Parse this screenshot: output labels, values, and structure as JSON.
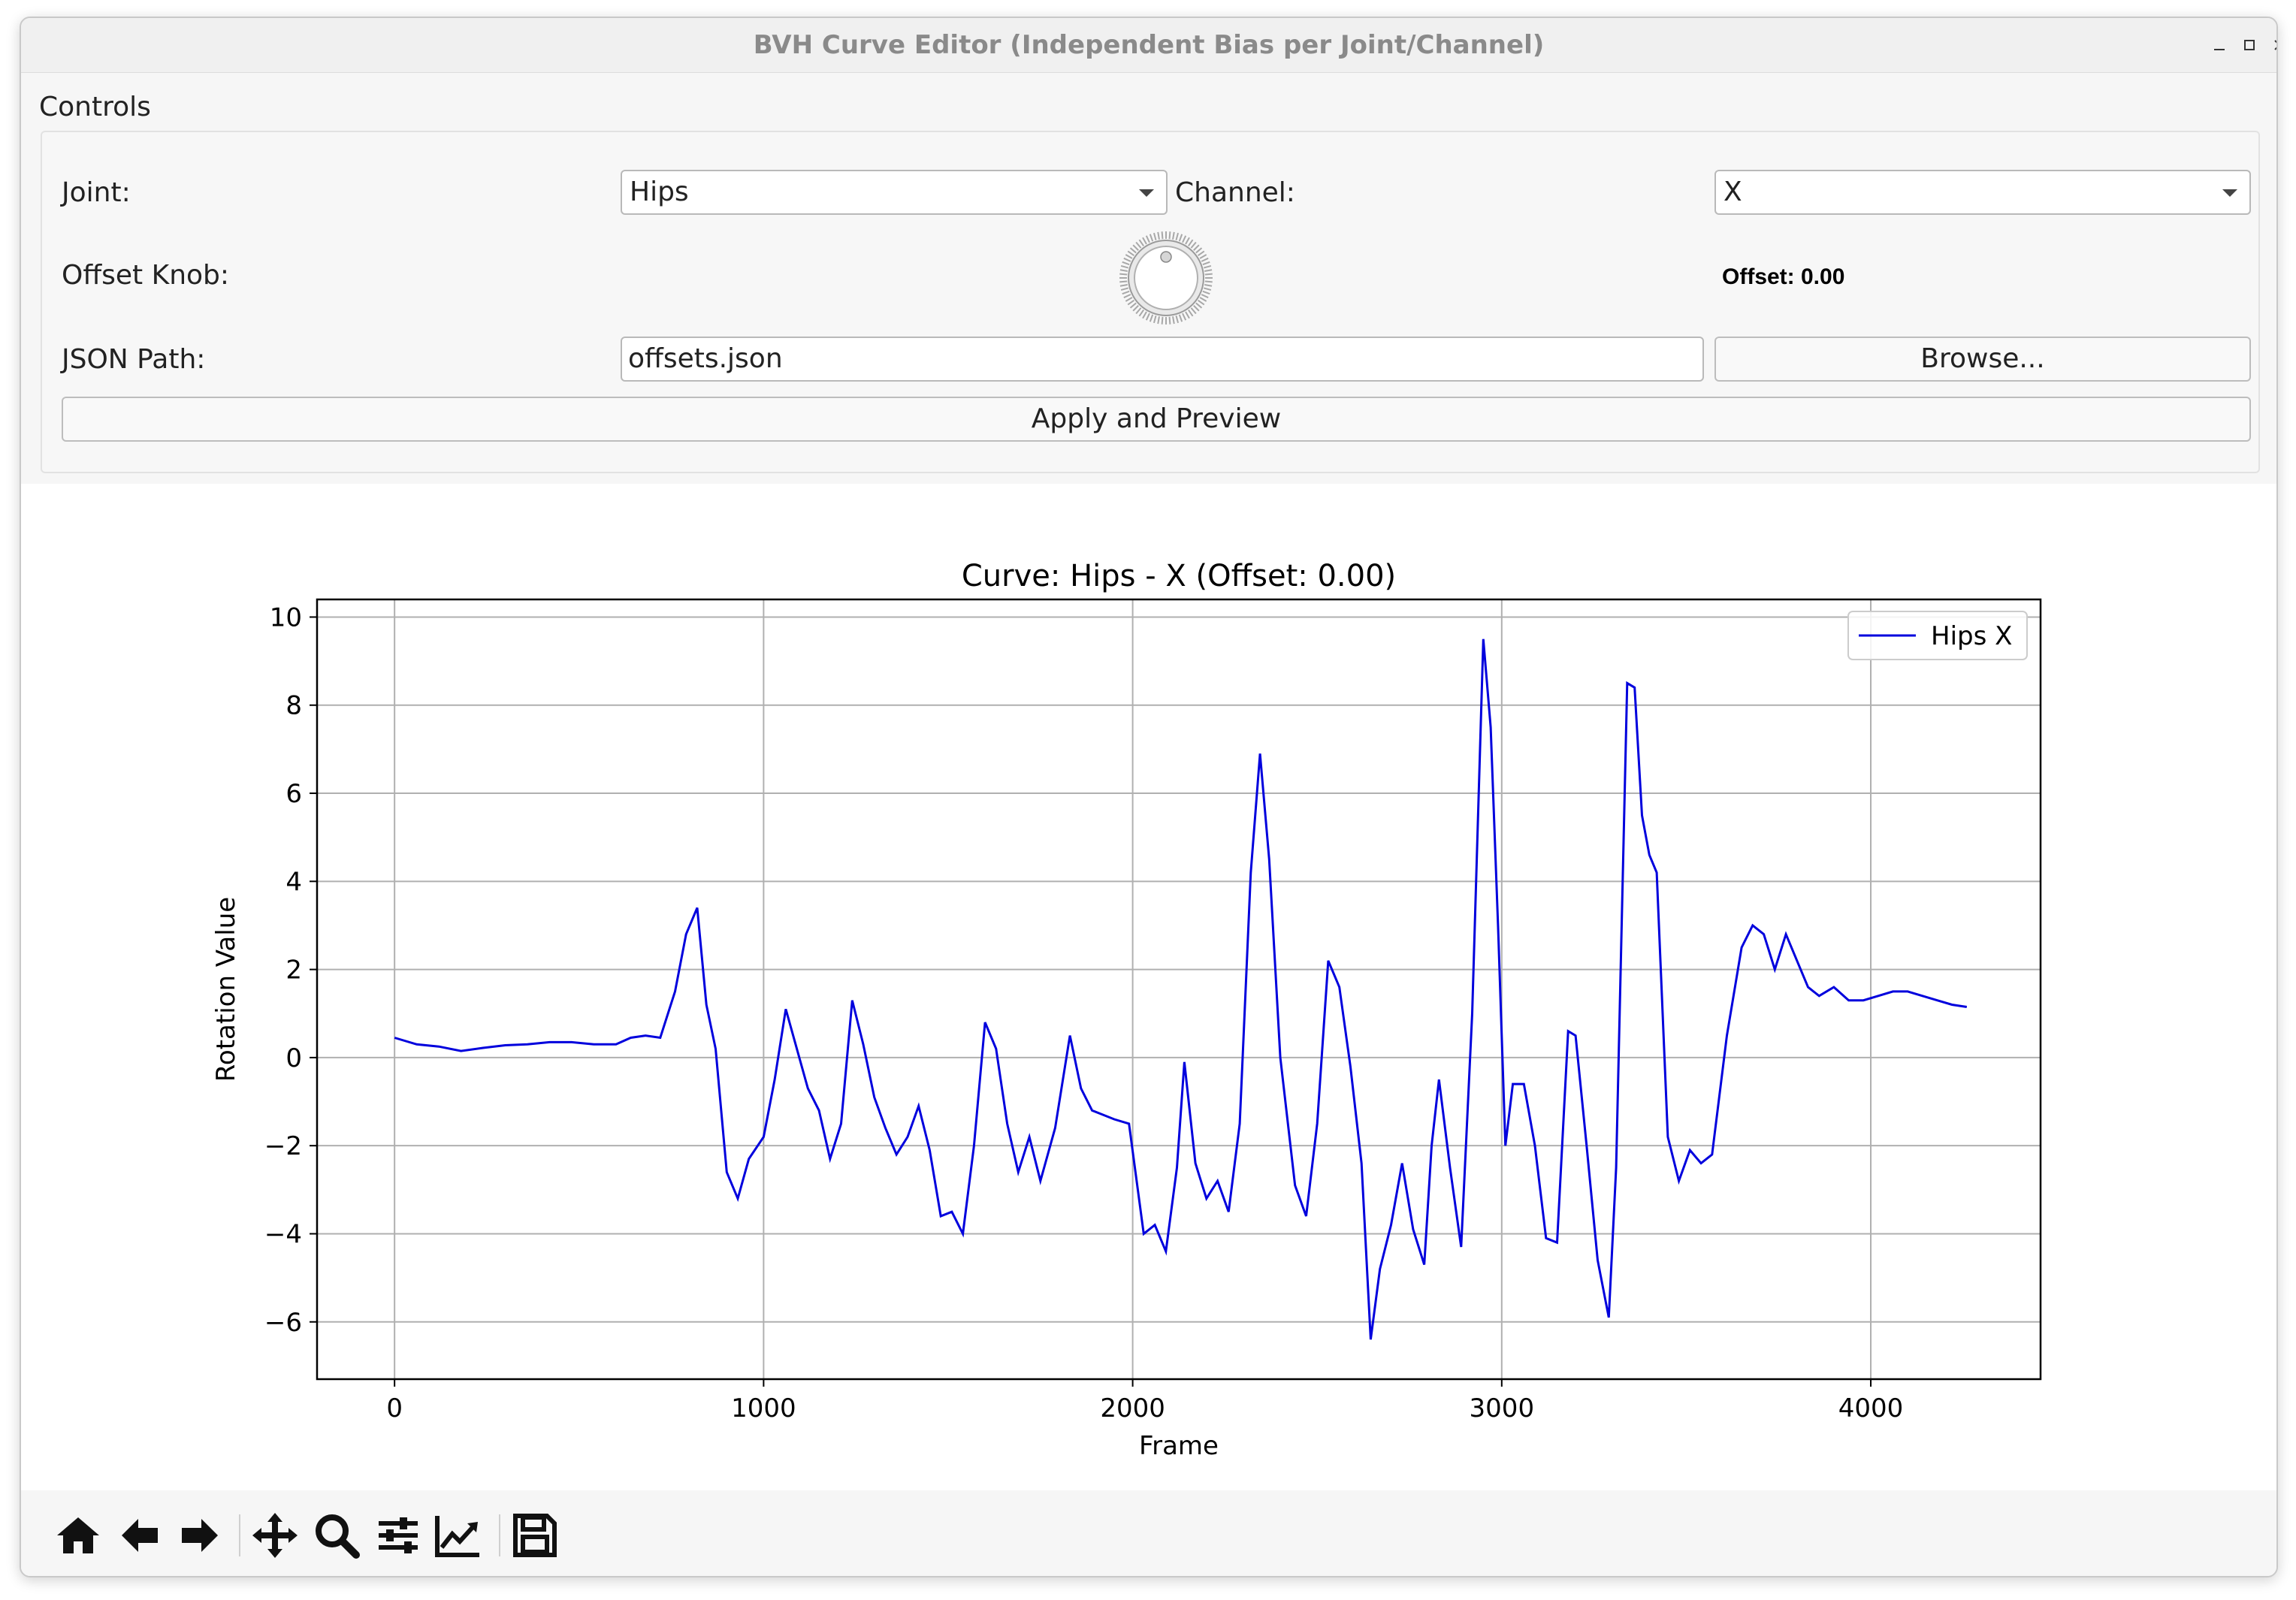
{
  "window": {
    "title": "BVH Curve Editor (Independent Bias per Joint/Channel)",
    "controls": [
      "minimize",
      "maximize",
      "close"
    ]
  },
  "controls": {
    "group_title": "Controls",
    "joint_label": "Joint:",
    "joint_value": "Hips",
    "channel_label": "Channel:",
    "channel_value": "X",
    "offset_knob_label": "Offset Knob:",
    "offset_value_text": "Offset: 0.00",
    "offset_value": 0.0,
    "json_path_label": "JSON Path:",
    "json_path_value": "offsets.json",
    "browse_label": "Browse...",
    "apply_label": "Apply and Preview"
  },
  "chart_data": {
    "type": "line",
    "title": "Curve: Hips - X (Offset: 0.00)",
    "xlabel": "Frame",
    "ylabel": "Rotation Value",
    "xlim": [
      -210,
      4460
    ],
    "ylim": [
      -7.3,
      10.4
    ],
    "xticks": [
      0,
      1000,
      2000,
      3000,
      4000
    ],
    "xtick_labels": [
      "0",
      "1000",
      "2000",
      "3000",
      "4000"
    ],
    "yticks": [
      10,
      8,
      6,
      4,
      2,
      0,
      -2,
      -4,
      -6
    ],
    "ytick_labels": [
      "10",
      "8",
      "6",
      "4",
      "2",
      "0",
      "−2",
      "−4",
      "−6"
    ],
    "grid": true,
    "legend": "top-right",
    "series": [
      {
        "name": "Hips X",
        "color": "#0000dd",
        "points": [
          [
            0,
            0.45
          ],
          [
            60,
            0.3
          ],
          [
            120,
            0.25
          ],
          [
            180,
            0.15
          ],
          [
            240,
            0.22
          ],
          [
            300,
            0.28
          ],
          [
            360,
            0.3
          ],
          [
            420,
            0.35
          ],
          [
            480,
            0.35
          ],
          [
            540,
            0.3
          ],
          [
            600,
            0.3
          ],
          [
            640,
            0.45
          ],
          [
            680,
            0.5
          ],
          [
            720,
            0.45
          ],
          [
            760,
            1.5
          ],
          [
            790,
            2.8
          ],
          [
            820,
            3.4
          ],
          [
            845,
            1.2
          ],
          [
            870,
            0.2
          ],
          [
            900,
            -2.6
          ],
          [
            930,
            -3.2
          ],
          [
            960,
            -2.3
          ],
          [
            1000,
            -1.8
          ],
          [
            1030,
            -0.5
          ],
          [
            1060,
            1.1
          ],
          [
            1090,
            0.2
          ],
          [
            1120,
            -0.7
          ],
          [
            1150,
            -1.2
          ],
          [
            1180,
            -2.3
          ],
          [
            1210,
            -1.5
          ],
          [
            1240,
            1.3
          ],
          [
            1270,
            0.3
          ],
          [
            1300,
            -0.9
          ],
          [
            1330,
            -1.6
          ],
          [
            1360,
            -2.2
          ],
          [
            1390,
            -1.8
          ],
          [
            1420,
            -1.1
          ],
          [
            1450,
            -2.1
          ],
          [
            1480,
            -3.6
          ],
          [
            1510,
            -3.5
          ],
          [
            1540,
            -4.0
          ],
          [
            1570,
            -2.0
          ],
          [
            1600,
            0.8
          ],
          [
            1630,
            0.2
          ],
          [
            1660,
            -1.5
          ],
          [
            1690,
            -2.6
          ],
          [
            1720,
            -1.8
          ],
          [
            1750,
            -2.8
          ],
          [
            1790,
            -1.6
          ],
          [
            1830,
            0.5
          ],
          [
            1860,
            -0.7
          ],
          [
            1890,
            -1.2
          ],
          [
            1920,
            -1.3
          ],
          [
            1950,
            -1.4
          ],
          [
            1990,
            -1.5
          ],
          [
            2030,
            -4.0
          ],
          [
            2060,
            -3.8
          ],
          [
            2090,
            -4.4
          ],
          [
            2120,
            -2.5
          ],
          [
            2140,
            -0.1
          ],
          [
            2170,
            -2.4
          ],
          [
            2200,
            -3.2
          ],
          [
            2230,
            -2.8
          ],
          [
            2260,
            -3.5
          ],
          [
            2290,
            -1.5
          ],
          [
            2320,
            4.2
          ],
          [
            2345,
            6.9
          ],
          [
            2370,
            4.5
          ],
          [
            2400,
            0.0
          ],
          [
            2440,
            -2.9
          ],
          [
            2470,
            -3.6
          ],
          [
            2500,
            -1.5
          ],
          [
            2530,
            2.2
          ],
          [
            2560,
            1.6
          ],
          [
            2590,
            -0.2
          ],
          [
            2620,
            -2.4
          ],
          [
            2645,
            -6.4
          ],
          [
            2670,
            -4.8
          ],
          [
            2700,
            -3.8
          ],
          [
            2730,
            -2.4
          ],
          [
            2760,
            -3.9
          ],
          [
            2790,
            -4.7
          ],
          [
            2810,
            -2.0
          ],
          [
            2830,
            -0.5
          ],
          [
            2860,
            -2.5
          ],
          [
            2890,
            -4.3
          ],
          [
            2920,
            1.0
          ],
          [
            2950,
            9.5
          ],
          [
            2970,
            7.5
          ],
          [
            2990,
            3.0
          ],
          [
            3010,
            -2.0
          ],
          [
            3030,
            -0.6
          ],
          [
            3060,
            -0.6
          ],
          [
            3090,
            -2.0
          ],
          [
            3120,
            -4.1
          ],
          [
            3150,
            -4.2
          ],
          [
            3180,
            0.6
          ],
          [
            3200,
            0.5
          ],
          [
            3230,
            -2.0
          ],
          [
            3260,
            -4.6
          ],
          [
            3290,
            -5.9
          ],
          [
            3310,
            -2.5
          ],
          [
            3340,
            8.5
          ],
          [
            3360,
            8.4
          ],
          [
            3380,
            5.5
          ],
          [
            3400,
            4.6
          ],
          [
            3420,
            4.2
          ],
          [
            3450,
            -1.8
          ],
          [
            3480,
            -2.8
          ],
          [
            3510,
            -2.1
          ],
          [
            3540,
            -2.4
          ],
          [
            3570,
            -2.2
          ],
          [
            3610,
            0.5
          ],
          [
            3650,
            2.5
          ],
          [
            3680,
            3.0
          ],
          [
            3710,
            2.8
          ],
          [
            3740,
            2.0
          ],
          [
            3770,
            2.8
          ],
          [
            3800,
            2.2
          ],
          [
            3830,
            1.6
          ],
          [
            3860,
            1.4
          ],
          [
            3900,
            1.6
          ],
          [
            3940,
            1.3
          ],
          [
            3980,
            1.3
          ],
          [
            4020,
            1.4
          ],
          [
            4060,
            1.5
          ],
          [
            4100,
            1.5
          ],
          [
            4140,
            1.4
          ],
          [
            4180,
            1.3
          ],
          [
            4220,
            1.2
          ],
          [
            4260,
            1.15
          ]
        ]
      }
    ]
  },
  "toolbar": {
    "icons": [
      "home-icon",
      "back-icon",
      "forward-icon",
      "pan-icon",
      "zoom-icon",
      "configure-subplots-icon",
      "edit-axis-icon",
      "save-icon"
    ]
  }
}
